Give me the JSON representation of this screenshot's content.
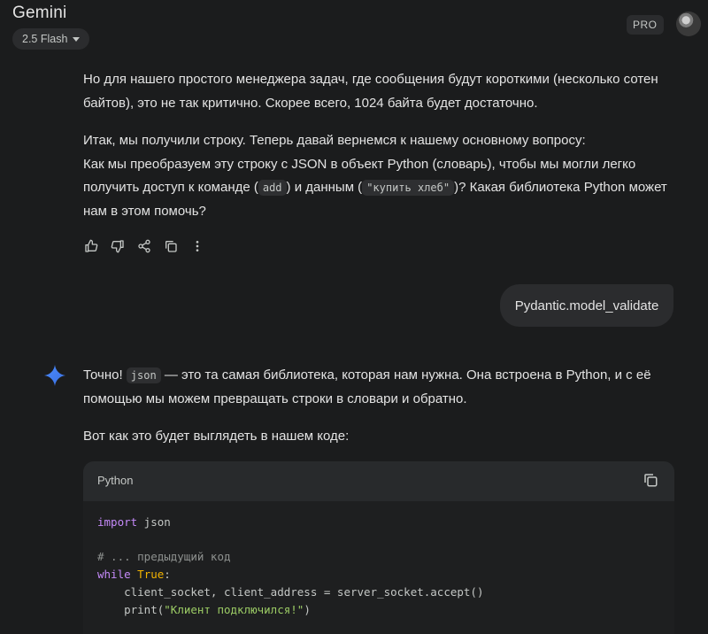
{
  "header": {
    "app_title": "Gemini",
    "model_label": "2.5 Flash",
    "pro_badge": "PRO"
  },
  "previous_reply": {
    "para1": "Но для нашего простого менеджера задач, где сообщения будут короткими (несколько сотен байтов), это не так критично. Скорее всего, 1024 байта будет достаточно.",
    "para2_line1": "Итак, мы получили строку. Теперь давай вернемся к нашему основному вопросу:",
    "para2_pre": "Как мы преобразуем эту строку с JSON в объект Python (словарь), чтобы мы могли легко получить доступ к команде (",
    "para2_chip1": "add",
    "para2_mid": ") и данным (",
    "para2_chip2": "\"купить хлеб\"",
    "para2_post": ")? Какая библиотека Python может нам в этом помочь?"
  },
  "actions": {
    "icons": [
      "thumb-up-icon",
      "thumb-down-icon",
      "share-icon",
      "copy-icon",
      "more-icon"
    ]
  },
  "user_message": {
    "text": "Pydantic.model_validate"
  },
  "reply": {
    "para1_pre": "Точно! ",
    "para1_chip": "json",
    "para1_post": " — это та самая библиотека, которая нам нужна. Она встроена в Python, и с её помощью мы можем превращать строки в словари и обратно.",
    "para2": "Вот как это будет выглядеть в нашем коде:"
  },
  "code": {
    "language": "Python",
    "line1_kw": "import",
    "line1_rest": " json",
    "line3": "# ... предыдущий код",
    "line4_kw": "while",
    "line4_bool": "True",
    "line4_rest": ":",
    "line5": "    client_socket, client_address = server_socket.accept()",
    "line6_pre": "    print(",
    "line6_str": "\"Клиент подключился!\"",
    "line6_post": ")"
  },
  "colors": {
    "background": "#1b1c1d",
    "keyword": "#c58af9",
    "boolean": "#f4b400",
    "string": "#9ccc65",
    "spark_blue": "#4a8cff"
  }
}
